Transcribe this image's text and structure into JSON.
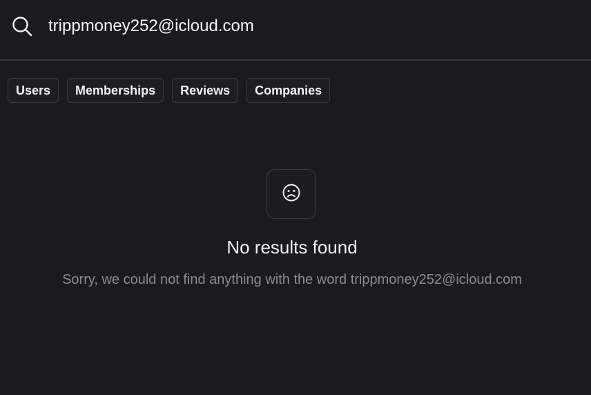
{
  "search": {
    "value": "trippmoney252@icloud.com",
    "icon": "search-icon"
  },
  "tabs": [
    {
      "label": "Users"
    },
    {
      "label": "Memberships"
    },
    {
      "label": "Reviews"
    },
    {
      "label": "Companies"
    }
  ],
  "empty_state": {
    "icon": "sad-face-icon",
    "title": "No results found",
    "message": "Sorry, we could not find anything with the word trippmoney252@icloud.com"
  },
  "colors": {
    "background": "#1b1a1e",
    "text": "#f2f2f3",
    "muted_text": "#8b8a90",
    "border": "#3a393e"
  }
}
